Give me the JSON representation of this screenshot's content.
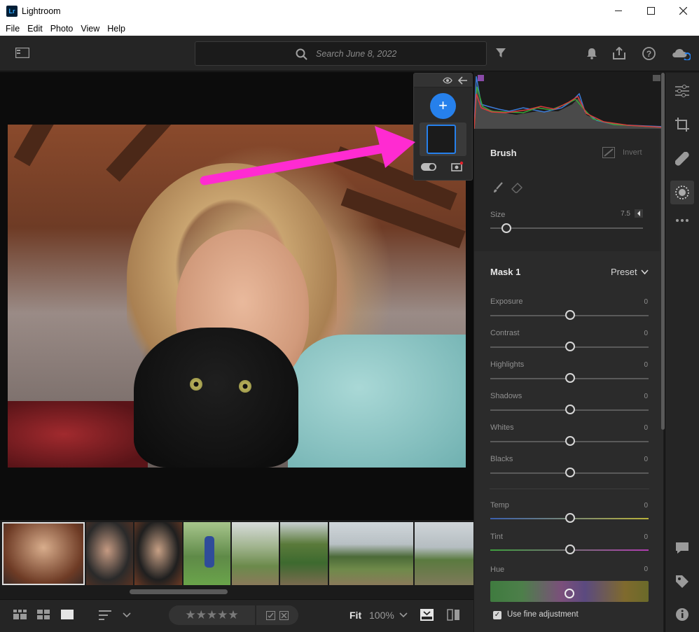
{
  "window": {
    "title": "Lightroom",
    "logo_text": "Lr",
    "controls": [
      "minimize",
      "maximize",
      "close"
    ]
  },
  "menu": {
    "items": [
      "File",
      "Edit",
      "Photo",
      "View",
      "Help"
    ]
  },
  "toolbar": {
    "search_placeholder": "Search June 8, 2022",
    "icons": [
      "panel-toggle-icon",
      "filter-icon",
      "bell-icon",
      "share-icon",
      "help-icon",
      "cloud-sync-icon"
    ]
  },
  "masks_panel": {
    "add_label": "+",
    "icons": [
      "eye-icon",
      "back-arrow-icon",
      "toggle-icon",
      "camera-icon"
    ]
  },
  "filmstrip": {
    "count": 9
  },
  "bottom_bar": {
    "stars": "★★★★★",
    "fit_label": "Fit",
    "zoom_label": "100%"
  },
  "brush": {
    "title": "Brush",
    "invert_label": "Invert",
    "size_label": "Size",
    "size_value": "7.5"
  },
  "mask": {
    "title": "Mask 1",
    "preset_label": "Preset",
    "sliders": [
      {
        "label": "Exposure",
        "value": "0"
      },
      {
        "label": "Contrast",
        "value": "0"
      },
      {
        "label": "Highlights",
        "value": "0"
      },
      {
        "label": "Shadows",
        "value": "0"
      },
      {
        "label": "Whites",
        "value": "0"
      },
      {
        "label": "Blacks",
        "value": "0"
      },
      {
        "label": "Temp",
        "value": "0"
      },
      {
        "label": "Tint",
        "value": "0"
      },
      {
        "label": "Hue",
        "value": "0"
      }
    ],
    "fine_adjust_label": "Use fine adjustment",
    "fine_adjust_checked": true
  },
  "colors": {
    "accent": "#2680eb",
    "annotation_arrow": "#ff2bd1",
    "panel_bg": "#2b2b2b"
  }
}
